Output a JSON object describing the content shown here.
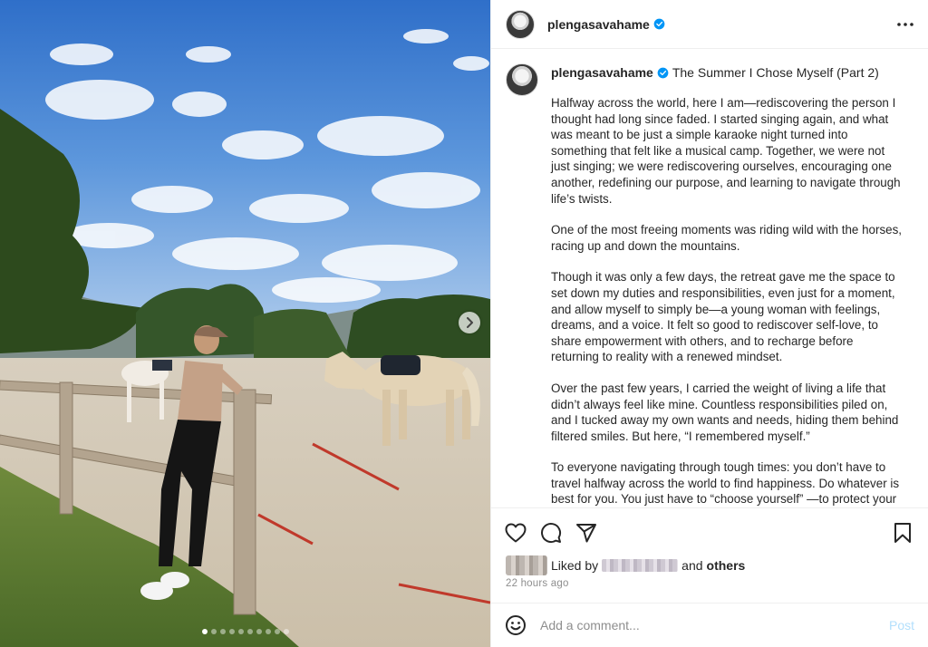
{
  "media": {
    "carousel_total": 10,
    "carousel_active": 1
  },
  "header": {
    "username": "plengasavahame",
    "verified": true
  },
  "caption": {
    "username": "plengasavahame",
    "title": "The Summer I Chose Myself (Part 2)",
    "paragraphs": [
      "Halfway across the world, here I am—rediscovering the person I thought had long since faded. I started singing again, and what was meant to be just a simple karaoke night turned into something that felt like a musical camp. Together, we were not just singing; we were rediscovering ourselves, encouraging one another, redefining our purpose, and learning to navigate through life’s twists.",
      "One of the most freeing moments was riding wild with the horses, racing up and down the mountains.",
      "Though it was only a few days, the retreat gave me the space to set down my duties and responsibilities, even just for a moment, and allow myself to simply be—a young woman with feelings, dreams, and a voice. It felt so good to rediscover self-love, to share empowerment with others, and to recharge before returning to reality with a renewed mindset.",
      "Over the past few years, I carried the weight of living a life that didn’t always feel like mine. Countless responsibilities piled on, and I tucked away my own wants and needs, hiding them behind filtered smiles. But here, “I remembered myself.”",
      "To everyone navigating through tough times: you don’t have to travel halfway across the world to find happiness. Do whatever is best for you. You just have to “choose yourself” —to protect your"
    ]
  },
  "likes": {
    "liked_by_prefix": "Liked by",
    "and_text": "and",
    "others_label": "others"
  },
  "timestamp": "22 hours ago",
  "comment": {
    "placeholder": "Add a comment...",
    "post_label": "Post"
  },
  "colors": {
    "verified": "#0095f6",
    "post_button": "#b2dffc",
    "muted_text": "#8e8e8e"
  },
  "icons": [
    "verified-badge-icon",
    "more-options-icon",
    "heart-icon",
    "comment-icon",
    "share-icon",
    "bookmark-icon",
    "emoji-icon",
    "chevron-right-icon"
  ]
}
